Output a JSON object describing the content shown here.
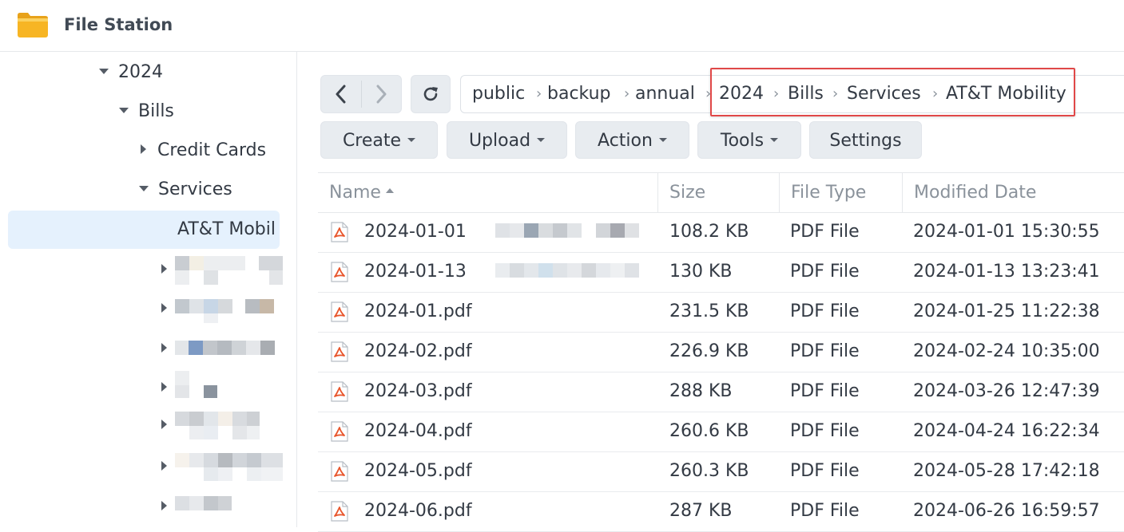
{
  "app": {
    "title": "File Station",
    "icon": "folder-icon"
  },
  "sidebar": {
    "tree": [
      {
        "label": "2024",
        "expanded": true
      },
      {
        "label": "Bills",
        "expanded": true
      },
      {
        "label": "Credit Cards",
        "expanded": false
      },
      {
        "label": "Services",
        "expanded": true
      },
      {
        "label": "AT&T Mobil",
        "selected": true
      }
    ]
  },
  "path": {
    "segments": [
      "public",
      "backup",
      "annual",
      "2024",
      "Bills",
      "Services",
      "AT&T Mobility"
    ]
  },
  "toolbar": {
    "create": "Create",
    "upload": "Upload",
    "action": "Action",
    "tools": "Tools",
    "settings": "Settings"
  },
  "table": {
    "columns": {
      "name": "Name",
      "size": "Size",
      "type": "File Type",
      "modified": "Modified Date"
    },
    "rows": [
      {
        "name": "2024-01-01",
        "size": "108.2 KB",
        "type": "PDF File",
        "modified": "2024-01-01 15:30:55"
      },
      {
        "name": "2024-01-13",
        "size": "130 KB",
        "type": "PDF File",
        "modified": "2024-01-13 13:23:41"
      },
      {
        "name": "2024-01.pdf",
        "size": "231.5 KB",
        "type": "PDF File",
        "modified": "2024-01-25 11:22:38"
      },
      {
        "name": "2024-02.pdf",
        "size": "226.9 KB",
        "type": "PDF File",
        "modified": "2024-02-24 10:35:00"
      },
      {
        "name": "2024-03.pdf",
        "size": "288 KB",
        "type": "PDF File",
        "modified": "2024-03-26 12:47:39"
      },
      {
        "name": "2024-04.pdf",
        "size": "260.6 KB",
        "type": "PDF File",
        "modified": "2024-04-24 16:22:34"
      },
      {
        "name": "2024-05.pdf",
        "size": "260.3 KB",
        "type": "PDF File",
        "modified": "2024-05-28 17:42:18"
      },
      {
        "name": "2024-06.pdf",
        "size": "287 KB",
        "type": "PDF File",
        "modified": "2024-06-26 16:59:57"
      }
    ]
  },
  "colors": {
    "selection": "#e5f1fd",
    "highlight_box": "#e04848",
    "pdf_icon": "#e8552b"
  }
}
